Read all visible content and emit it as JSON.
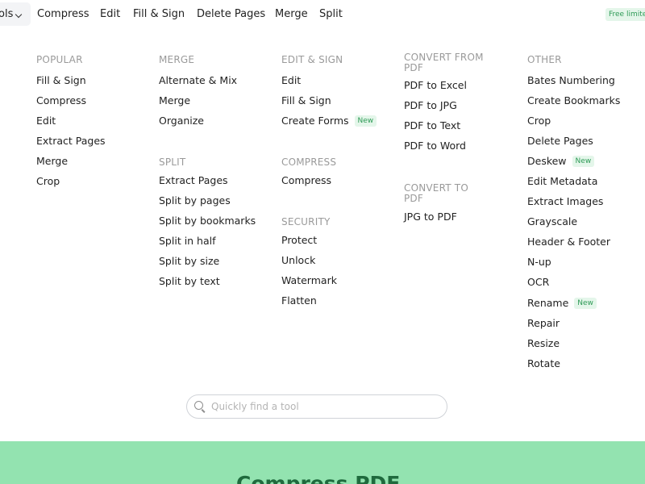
{
  "nav": {
    "tools_label": "ols",
    "items": [
      "Compress",
      "Edit",
      "Fill & Sign",
      "Delete Pages",
      "Merge",
      "Split"
    ],
    "free_badge": "Free limite"
  },
  "menu": {
    "popular": {
      "heading": "POPULAR",
      "items": [
        "Fill & Sign",
        "Compress",
        "Edit",
        "Extract Pages",
        "Merge",
        "Crop"
      ]
    },
    "merge": {
      "heading": "MERGE",
      "items": [
        "Alternate & Mix",
        "Merge",
        "Organize"
      ]
    },
    "split": {
      "heading": "SPLIT",
      "items": [
        "Extract Pages",
        "Split by pages",
        "Split by bookmarks",
        "Split in half",
        "Split by size",
        "Split by text"
      ]
    },
    "edit_sign": {
      "heading": "EDIT & SIGN",
      "items": [
        "Edit",
        "Fill & Sign",
        "Create Forms"
      ]
    },
    "compress": {
      "heading": "COMPRESS",
      "items": [
        "Compress"
      ]
    },
    "security": {
      "heading": "SECURITY",
      "items": [
        "Protect",
        "Unlock",
        "Watermark",
        "Flatten"
      ]
    },
    "convert_from": {
      "heading_1": "CONVERT FROM",
      "heading_2": "PDF",
      "items": [
        "PDF to Excel",
        "PDF to JPG",
        "PDF to Text",
        "PDF to Word"
      ]
    },
    "convert_to": {
      "heading_1": "CONVERT TO",
      "heading_2": "PDF",
      "items": [
        "JPG to PDF"
      ]
    },
    "other": {
      "heading": "OTHER",
      "items": [
        "Bates Numbering",
        "Create Bookmarks",
        "Crop",
        "Delete Pages",
        "Deskew",
        "Edit Metadata",
        "Extract Images",
        "Grayscale",
        "Header & Footer",
        "N-up",
        "OCR",
        "Rename",
        "Repair",
        "Resize",
        "Rotate"
      ]
    },
    "new_label": "New"
  },
  "search": {
    "placeholder": "Quickly find a tool"
  },
  "hero": {
    "title": "Compress PDF"
  },
  "colors": {
    "accent_green": "#93e3b0",
    "badge_text": "#2f9b57",
    "hero_text": "#1f6a3d"
  },
  "icons": {
    "search": "search-icon",
    "dropdown": "chevron-down-icon"
  }
}
